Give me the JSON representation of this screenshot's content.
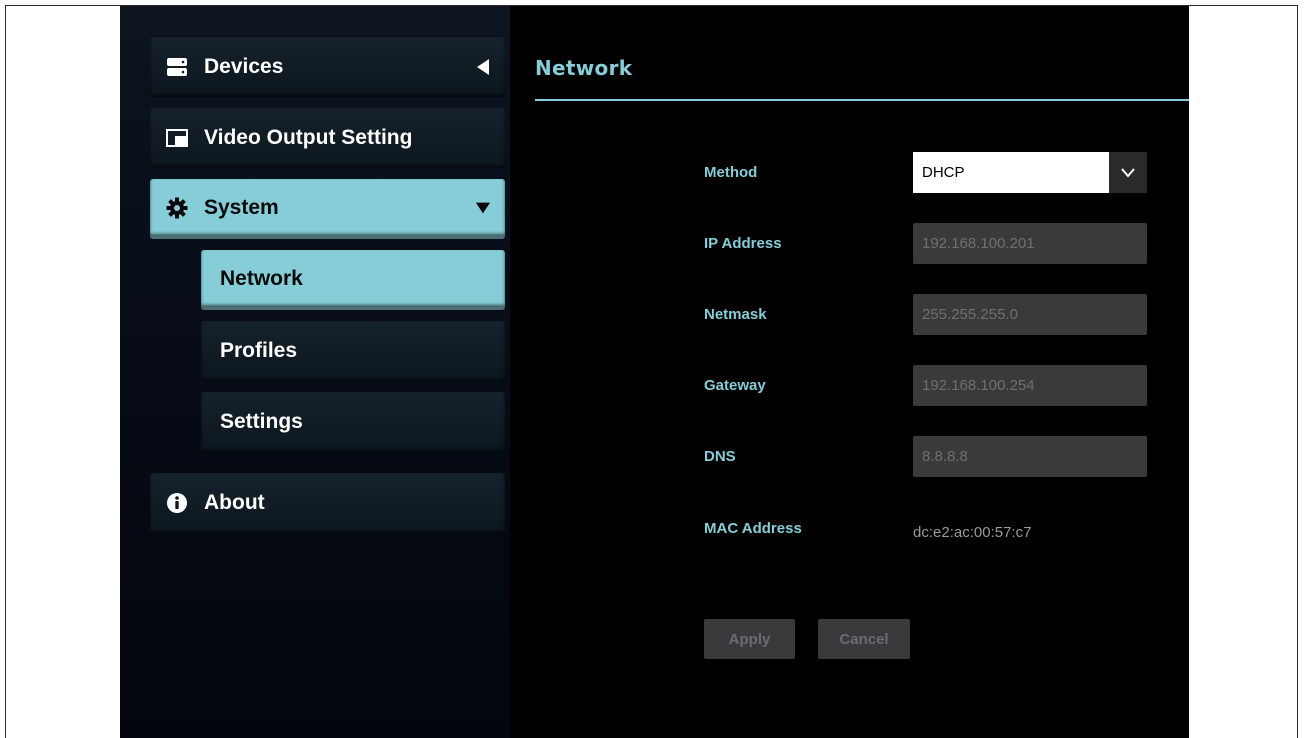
{
  "sidebar": {
    "items": [
      {
        "label": "Devices",
        "icon": "server-icon",
        "arrow": "chevron-left-icon"
      },
      {
        "label": "Video Output Setting",
        "icon": "pip-icon"
      },
      {
        "label": "System",
        "icon": "gear-icon",
        "arrow": "chevron-down-icon",
        "active": true
      },
      {
        "label": "Network",
        "active": true
      },
      {
        "label": "Profiles"
      },
      {
        "label": "Settings"
      },
      {
        "label": "About",
        "icon": "info-icon"
      }
    ]
  },
  "main": {
    "title": "Network",
    "form": {
      "method_label": "Method",
      "method_value": "DHCP",
      "ip_label": "IP Address",
      "ip_value": "192.168.100.201",
      "netmask_label": "Netmask",
      "netmask_value": "255.255.255.0",
      "gateway_label": "Gateway",
      "gateway_value": "192.168.100.254",
      "dns_label": "DNS",
      "dns_value": "8.8.8.8",
      "mac_label": "MAC Address",
      "mac_value": "dc:e2:ac:00:57:c7"
    },
    "buttons": {
      "apply": "Apply",
      "cancel": "Cancel"
    }
  },
  "colors": {
    "accent": "#86cdd7",
    "background": "#000000",
    "field_disabled": "#3a3a3c"
  }
}
